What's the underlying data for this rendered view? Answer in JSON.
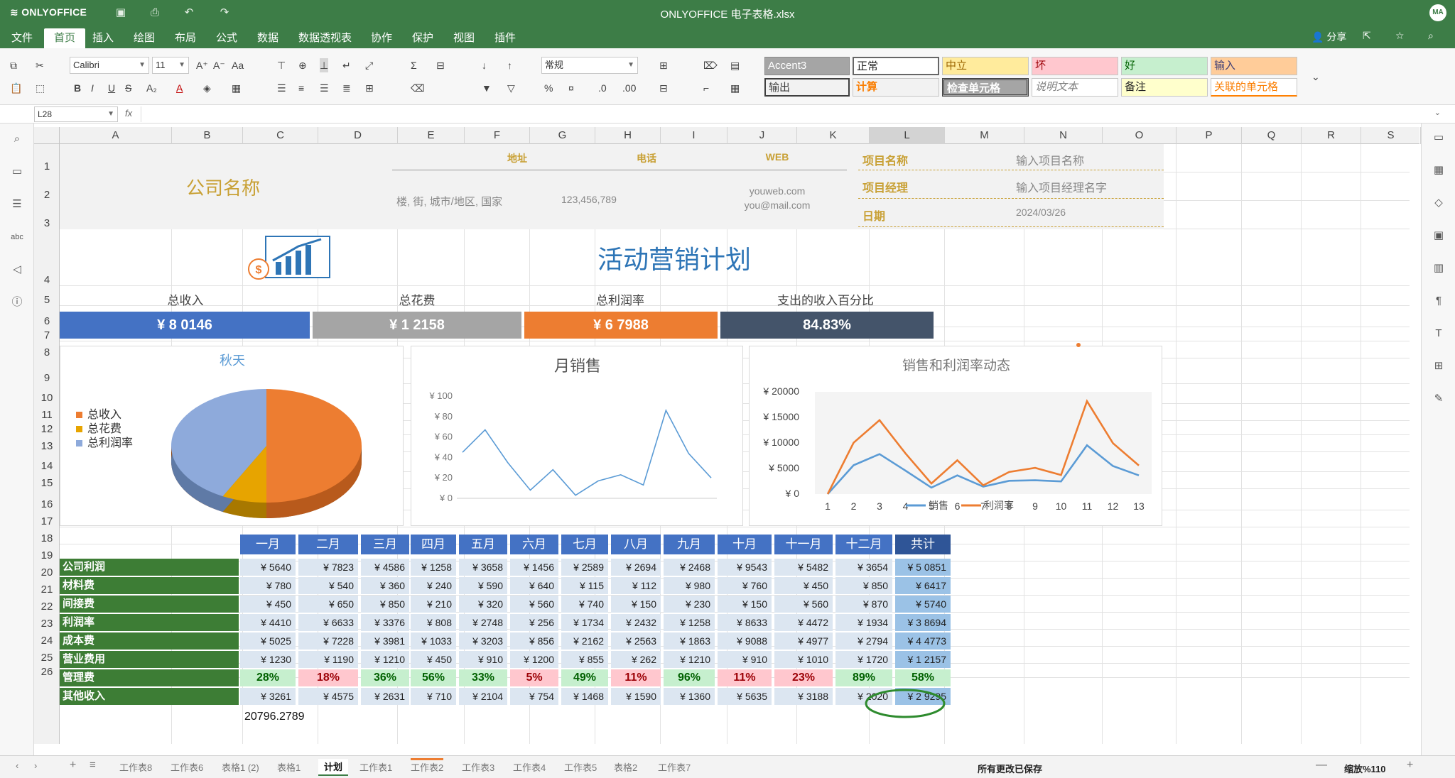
{
  "app": {
    "logo": "ONLYOFFICE",
    "title": "ONLYOFFICE 电子表格.xlsx",
    "avatar": "MA",
    "share": "分享"
  },
  "menu": {
    "file": "文件",
    "tabs": [
      "首页",
      "插入",
      "绘图",
      "布局",
      "公式",
      "数据",
      "数据透视表",
      "协作",
      "保护",
      "视图",
      "插件"
    ]
  },
  "toolbar": {
    "font_name": "Calibri",
    "font_size": "11",
    "number_format": "常规",
    "sum_symbol": "Σ"
  },
  "cell_styles": [
    "Accent3",
    "正常",
    "中立",
    "坏",
    "好",
    "输入",
    "输出",
    "计算",
    "检查单元格",
    "说明文本",
    "备注",
    "关联的单元格"
  ],
  "formula_bar": {
    "cell_ref": "L28",
    "fx": "fx",
    "value": ""
  },
  "columns": [
    "A",
    "B",
    "C",
    "D",
    "E",
    "F",
    "G",
    "H",
    "I",
    "J",
    "K",
    "L",
    "M",
    "N",
    "O",
    "P",
    "Q",
    "R",
    "S"
  ],
  "rows": [
    "1",
    "2",
    "3",
    "4",
    "5",
    "6",
    "7",
    "8",
    "9",
    "10",
    "11",
    "12",
    "13",
    "14",
    "15",
    "16",
    "17",
    "18",
    "19",
    "20",
    "21",
    "22",
    "23",
    "24",
    "25",
    "26"
  ],
  "header": {
    "company": "公司名称",
    "addr_label": "地址",
    "phone_label": "电话",
    "web_label": "WEB",
    "addr": "楼, 街, 城市/地区, 国家",
    "phone": "123,456,789",
    "web1": "youweb.com",
    "web2": "you@mail.com",
    "proj_name_label": "项目名称",
    "proj_name": "输入项目名称",
    "proj_mgr_label": "项目经理",
    "proj_mgr": "输入项目经理名字",
    "date_label": "日期",
    "date": "2024/03/26",
    "title": "活动营销计划"
  },
  "kpis": [
    {
      "label": "总收入",
      "value": "¥ 8 0146",
      "color": "#4472c4"
    },
    {
      "label": "总花费",
      "value": "¥ 1 2158",
      "color": "#a5a5a5"
    },
    {
      "label": "总利润率",
      "value": "¥ 6 7988",
      "color": "#ed7d31"
    },
    {
      "label": "支出的收入百分比",
      "value": "84.83%",
      "color": "#44546a"
    }
  ],
  "months": [
    "一月",
    "二月",
    "三月",
    "四月",
    "五月",
    "六月",
    "七月",
    "八月",
    "九月",
    "十月",
    "十一月",
    "十二月",
    "共计"
  ],
  "table_rows": [
    {
      "label": "公司利润",
      "values": [
        "¥ 5640",
        "¥ 7823",
        "¥ 4586",
        "¥ 1258",
        "¥ 3658",
        "¥ 1456",
        "¥ 2589",
        "¥ 2694",
        "¥ 2468",
        "¥ 9543",
        "¥ 5482",
        "¥ 3654",
        "¥ 5 0851"
      ]
    },
    {
      "label": "材料费",
      "values": [
        "¥ 780",
        "¥ 540",
        "¥ 360",
        "¥ 240",
        "¥ 590",
        "¥ 640",
        "¥ 115",
        "¥ 112",
        "¥ 980",
        "¥ 760",
        "¥ 450",
        "¥ 850",
        "¥ 6417"
      ]
    },
    {
      "label": "间接费",
      "values": [
        "¥ 450",
        "¥ 650",
        "¥ 850",
        "¥ 210",
        "¥ 320",
        "¥ 560",
        "¥ 740",
        "¥ 150",
        "¥ 230",
        "¥ 150",
        "¥ 560",
        "¥ 870",
        "¥ 5740"
      ]
    },
    {
      "label": "利润率",
      "values": [
        "¥ 4410",
        "¥ 6633",
        "¥ 3376",
        "¥ 808",
        "¥ 2748",
        "¥ 256",
        "¥ 1734",
        "¥ 2432",
        "¥ 1258",
        "¥ 8633",
        "¥ 4472",
        "¥ 1934",
        "¥ 3 8694"
      ]
    },
    {
      "label": "成本费",
      "values": [
        "¥ 5025",
        "¥ 7228",
        "¥ 3981",
        "¥ 1033",
        "¥ 3203",
        "¥ 856",
        "¥ 2162",
        "¥ 2563",
        "¥ 1863",
        "¥ 9088",
        "¥ 4977",
        "¥ 2794",
        "¥ 4 4773"
      ]
    },
    {
      "label": "营业费用",
      "values": [
        "¥ 1230",
        "¥ 1190",
        "¥ 1210",
        "¥ 450",
        "¥ 910",
        "¥ 1200",
        "¥ 855",
        "¥ 262",
        "¥ 1210",
        "¥ 910",
        "¥ 1010",
        "¥ 1720",
        "¥ 1 2157"
      ]
    }
  ],
  "pct_row": {
    "label": "管理费",
    "values": [
      "28%",
      "18%",
      "36%",
      "56%",
      "33%",
      "5%",
      "49%",
      "11%",
      "96%",
      "11%",
      "23%",
      "89%",
      "58%"
    ],
    "good": [
      true,
      false,
      true,
      true,
      true,
      false,
      true,
      false,
      true,
      false,
      false,
      true,
      true
    ]
  },
  "other_row": {
    "label": "其他收入",
    "values": [
      "¥ 3261",
      "¥ 4575",
      "¥ 2631",
      "¥ 710",
      "¥ 2104",
      "¥ 754",
      "¥ 1468",
      "¥ 1590",
      "¥ 1360",
      "¥ 5635",
      "¥ 3188",
      "¥ 2020",
      "¥ 2 9295"
    ]
  },
  "row25_value": "20796.2789",
  "colors": {
    "brand": "#3d7d47",
    "header_blue": "#4472c4",
    "row_green": "#3d7d35",
    "good_bg": "#c6efce",
    "good_fg": "#006100",
    "bad_bg": "#ffc7ce",
    "bad_fg": "#9c0006",
    "orange": "#ed7d31",
    "gray": "#a5a5a5",
    "light_blue": "#dce6f1"
  },
  "sheets": [
    "工作表8",
    "工作表6",
    "表格1 (2)",
    "表格1",
    "计划",
    "工作表1",
    "工作表2",
    "工作表3",
    "工作表4",
    "工作表5",
    "表格2",
    "工作表7"
  ],
  "active_sheet_index": 4,
  "status": {
    "saved": "所有更改已保存",
    "zoom": "缩放%110"
  },
  "chart_data": [
    {
      "type": "pie",
      "title": "秋天",
      "categories": [
        "总收入",
        "总花费",
        "总利润率"
      ],
      "values": [
        8.0146,
        1.2158,
        6.7988
      ],
      "colors": [
        "#ed7d31",
        "#e7a400",
        "#8eaadb"
      ],
      "legend": "left"
    },
    {
      "type": "line",
      "title": "月销售",
      "x": [
        1,
        2,
        3,
        4,
        5,
        6,
        7,
        8,
        9,
        10,
        11,
        12,
        13
      ],
      "series": [
        {
          "values": [
            45,
            67,
            35,
            8,
            28,
            3,
            17,
            23,
            13,
            86,
            44,
            20
          ]
        }
      ],
      "ylim": [
        0,
        100
      ],
      "yticks": [
        "¥ 100",
        "¥ 80",
        "¥ 60",
        "¥ 40",
        "¥ 20",
        "¥ 0"
      ],
      "color": "#5b9bd5"
    },
    {
      "type": "line",
      "title": "销售和利润率动态",
      "x": [
        "1",
        "2",
        "3",
        "4",
        "5",
        "6",
        "7",
        "8",
        "9",
        "10",
        "11",
        "12",
        "13"
      ],
      "series": [
        {
          "name": "销售",
          "values": [
            0,
            5640,
            7823,
            4586,
            1258,
            3658,
            1456,
            2589,
            2694,
            2468,
            9543,
            5482,
            3654
          ],
          "color": "#5b9bd5"
        },
        {
          "name": "利润率",
          "values": [
            0,
            10050,
            14456,
            7962,
            2066,
            6606,
            1712,
            4323,
            5126,
            3726,
            18176,
            9954,
            5588
          ],
          "color": "#ed7d31"
        }
      ],
      "ylim": [
        0,
        20000
      ],
      "yticks": [
        "¥ 20000",
        "¥ 15000",
        "¥ 10000",
        "¥ 5000",
        "¥ 0"
      ],
      "legend": "bottom"
    }
  ]
}
